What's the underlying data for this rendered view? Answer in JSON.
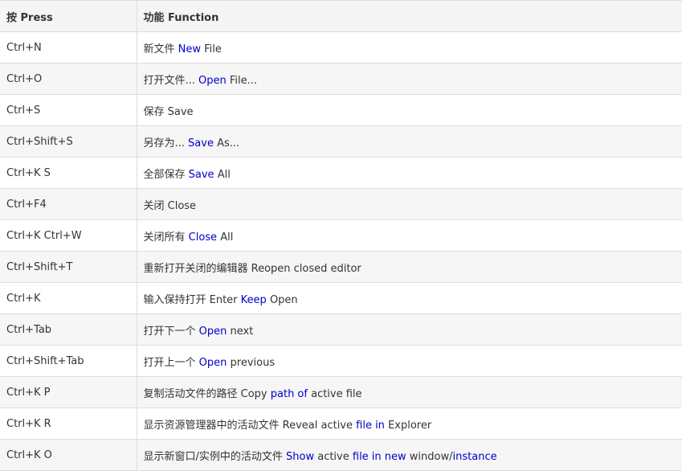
{
  "table": {
    "header": {
      "press": "按 Press",
      "function": "功能 Function"
    },
    "rows": [
      {
        "key": "Ctrl+N",
        "segments": [
          {
            "text": "新文件 ",
            "hl": false
          },
          {
            "text": "New",
            "hl": true
          },
          {
            "text": " File",
            "hl": false
          }
        ]
      },
      {
        "key": "Ctrl+O",
        "segments": [
          {
            "text": "打开文件... ",
            "hl": false
          },
          {
            "text": "Open",
            "hl": true
          },
          {
            "text": " File...",
            "hl": false
          }
        ]
      },
      {
        "key": "Ctrl+S",
        "segments": [
          {
            "text": "保存 Save",
            "hl": false
          }
        ]
      },
      {
        "key": "Ctrl+Shift+S",
        "segments": [
          {
            "text": "另存为... ",
            "hl": false
          },
          {
            "text": "Save",
            "hl": true
          },
          {
            "text": " As...",
            "hl": false
          }
        ]
      },
      {
        "key": "Ctrl+K S",
        "segments": [
          {
            "text": "全部保存 ",
            "hl": false
          },
          {
            "text": "Save",
            "hl": true
          },
          {
            "text": " All",
            "hl": false
          }
        ]
      },
      {
        "key": "Ctrl+F4",
        "segments": [
          {
            "text": "关闭 Close",
            "hl": false
          }
        ]
      },
      {
        "key": "Ctrl+K Ctrl+W",
        "segments": [
          {
            "text": "关闭所有 ",
            "hl": false
          },
          {
            "text": "Close",
            "hl": true
          },
          {
            "text": " All",
            "hl": false
          }
        ]
      },
      {
        "key": "Ctrl+Shift+T",
        "segments": [
          {
            "text": "重新打开关闭的编辑器 Reopen closed editor",
            "hl": false
          }
        ]
      },
      {
        "key": "Ctrl+K",
        "segments": [
          {
            "text": "输入保持打开 Enter ",
            "hl": false
          },
          {
            "text": "Keep",
            "hl": true
          },
          {
            "text": " Open",
            "hl": false
          }
        ]
      },
      {
        "key": "Ctrl+Tab",
        "segments": [
          {
            "text": "打开下一个 ",
            "hl": false
          },
          {
            "text": "Open",
            "hl": true
          },
          {
            "text": " next",
            "hl": false
          }
        ]
      },
      {
        "key": "Ctrl+Shift+Tab",
        "segments": [
          {
            "text": "打开上一个 ",
            "hl": false
          },
          {
            "text": "Open",
            "hl": true
          },
          {
            "text": " previous",
            "hl": false
          }
        ]
      },
      {
        "key": "Ctrl+K P",
        "segments": [
          {
            "text": "复制活动文件的路径 Copy ",
            "hl": false
          },
          {
            "text": "path of",
            "hl": true
          },
          {
            "text": " active file",
            "hl": false
          }
        ]
      },
      {
        "key": "Ctrl+K R",
        "segments": [
          {
            "text": "显示资源管理器中的活动文件 Reveal active ",
            "hl": false
          },
          {
            "text": "file in",
            "hl": true
          },
          {
            "text": " Explorer",
            "hl": false
          }
        ]
      },
      {
        "key": "Ctrl+K O",
        "segments": [
          {
            "text": "显示新窗口/实例中的活动文件 ",
            "hl": false
          },
          {
            "text": "Show",
            "hl": true
          },
          {
            "text": " active ",
            "hl": false
          },
          {
            "text": "file in new",
            "hl": true
          },
          {
            "text": " window/",
            "hl": false
          },
          {
            "text": "instance",
            "hl": true
          }
        ]
      }
    ]
  }
}
